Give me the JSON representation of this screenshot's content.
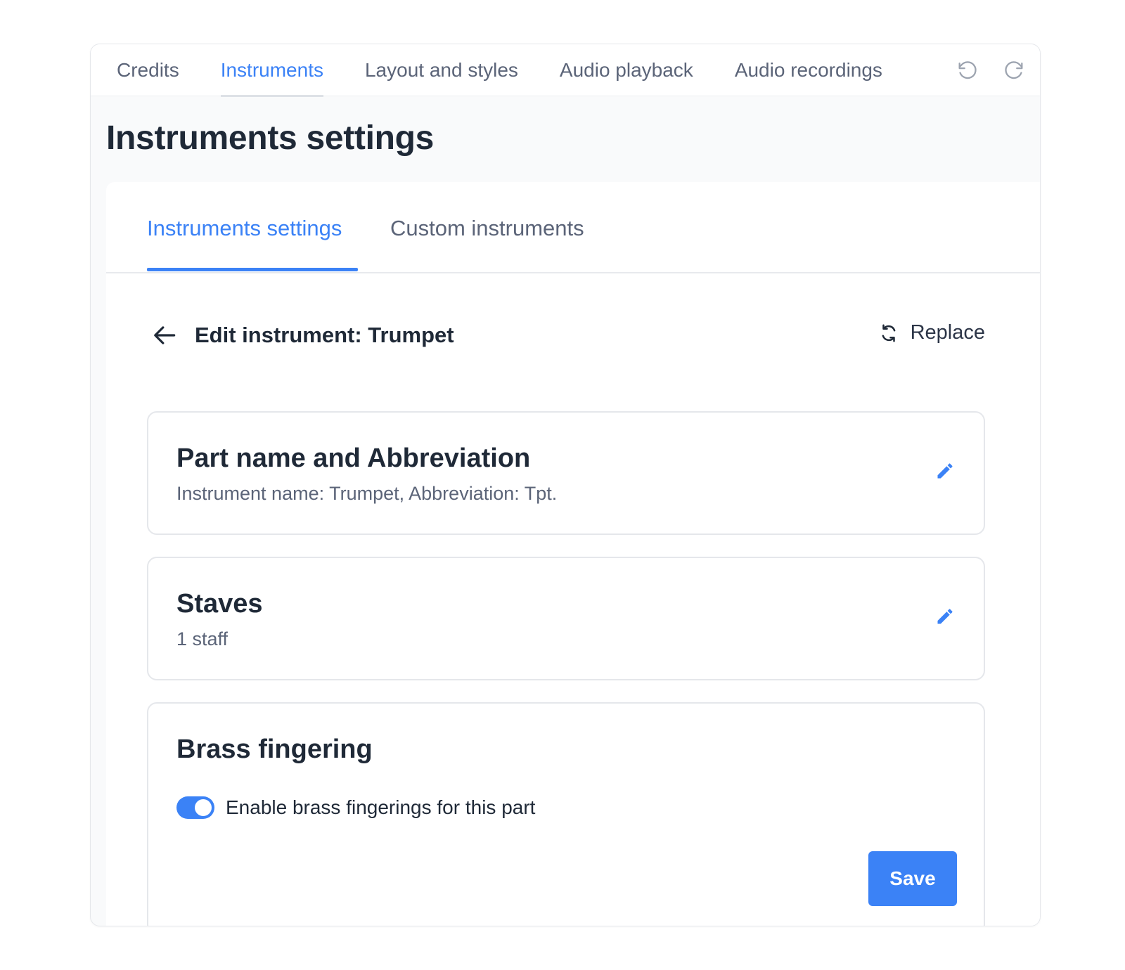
{
  "top_tabs": [
    {
      "label": "Credits",
      "active": false
    },
    {
      "label": "Instruments",
      "active": true
    },
    {
      "label": "Layout and styles",
      "active": false
    },
    {
      "label": "Audio playback",
      "active": false
    },
    {
      "label": "Audio recordings",
      "active": false
    }
  ],
  "history": {
    "undo_icon": "undo-icon",
    "redo_icon": "redo-icon"
  },
  "page": {
    "title": "Instruments settings"
  },
  "sub_tabs": [
    {
      "label": "Instruments settings",
      "active": true
    },
    {
      "label": "Custom instruments",
      "active": false
    }
  ],
  "edit": {
    "title": "Edit instrument: Trumpet",
    "back_icon": "arrow-left-icon",
    "replace_label": "Replace",
    "replace_icon": "refresh-icon"
  },
  "cards": {
    "part_name": {
      "title": "Part name and Abbreviation",
      "subtitle": "Instrument name: Trumpet, Abbreviation: Tpt."
    },
    "staves": {
      "title": "Staves",
      "subtitle": "1 staff"
    },
    "brass": {
      "title": "Brass fingering",
      "toggle_label": "Enable brass fingerings for this part",
      "toggle_on": true,
      "save_label": "Save"
    }
  },
  "colors": {
    "accent": "#3b82f6",
    "text": "#1f2937",
    "muted": "#5b6478"
  }
}
